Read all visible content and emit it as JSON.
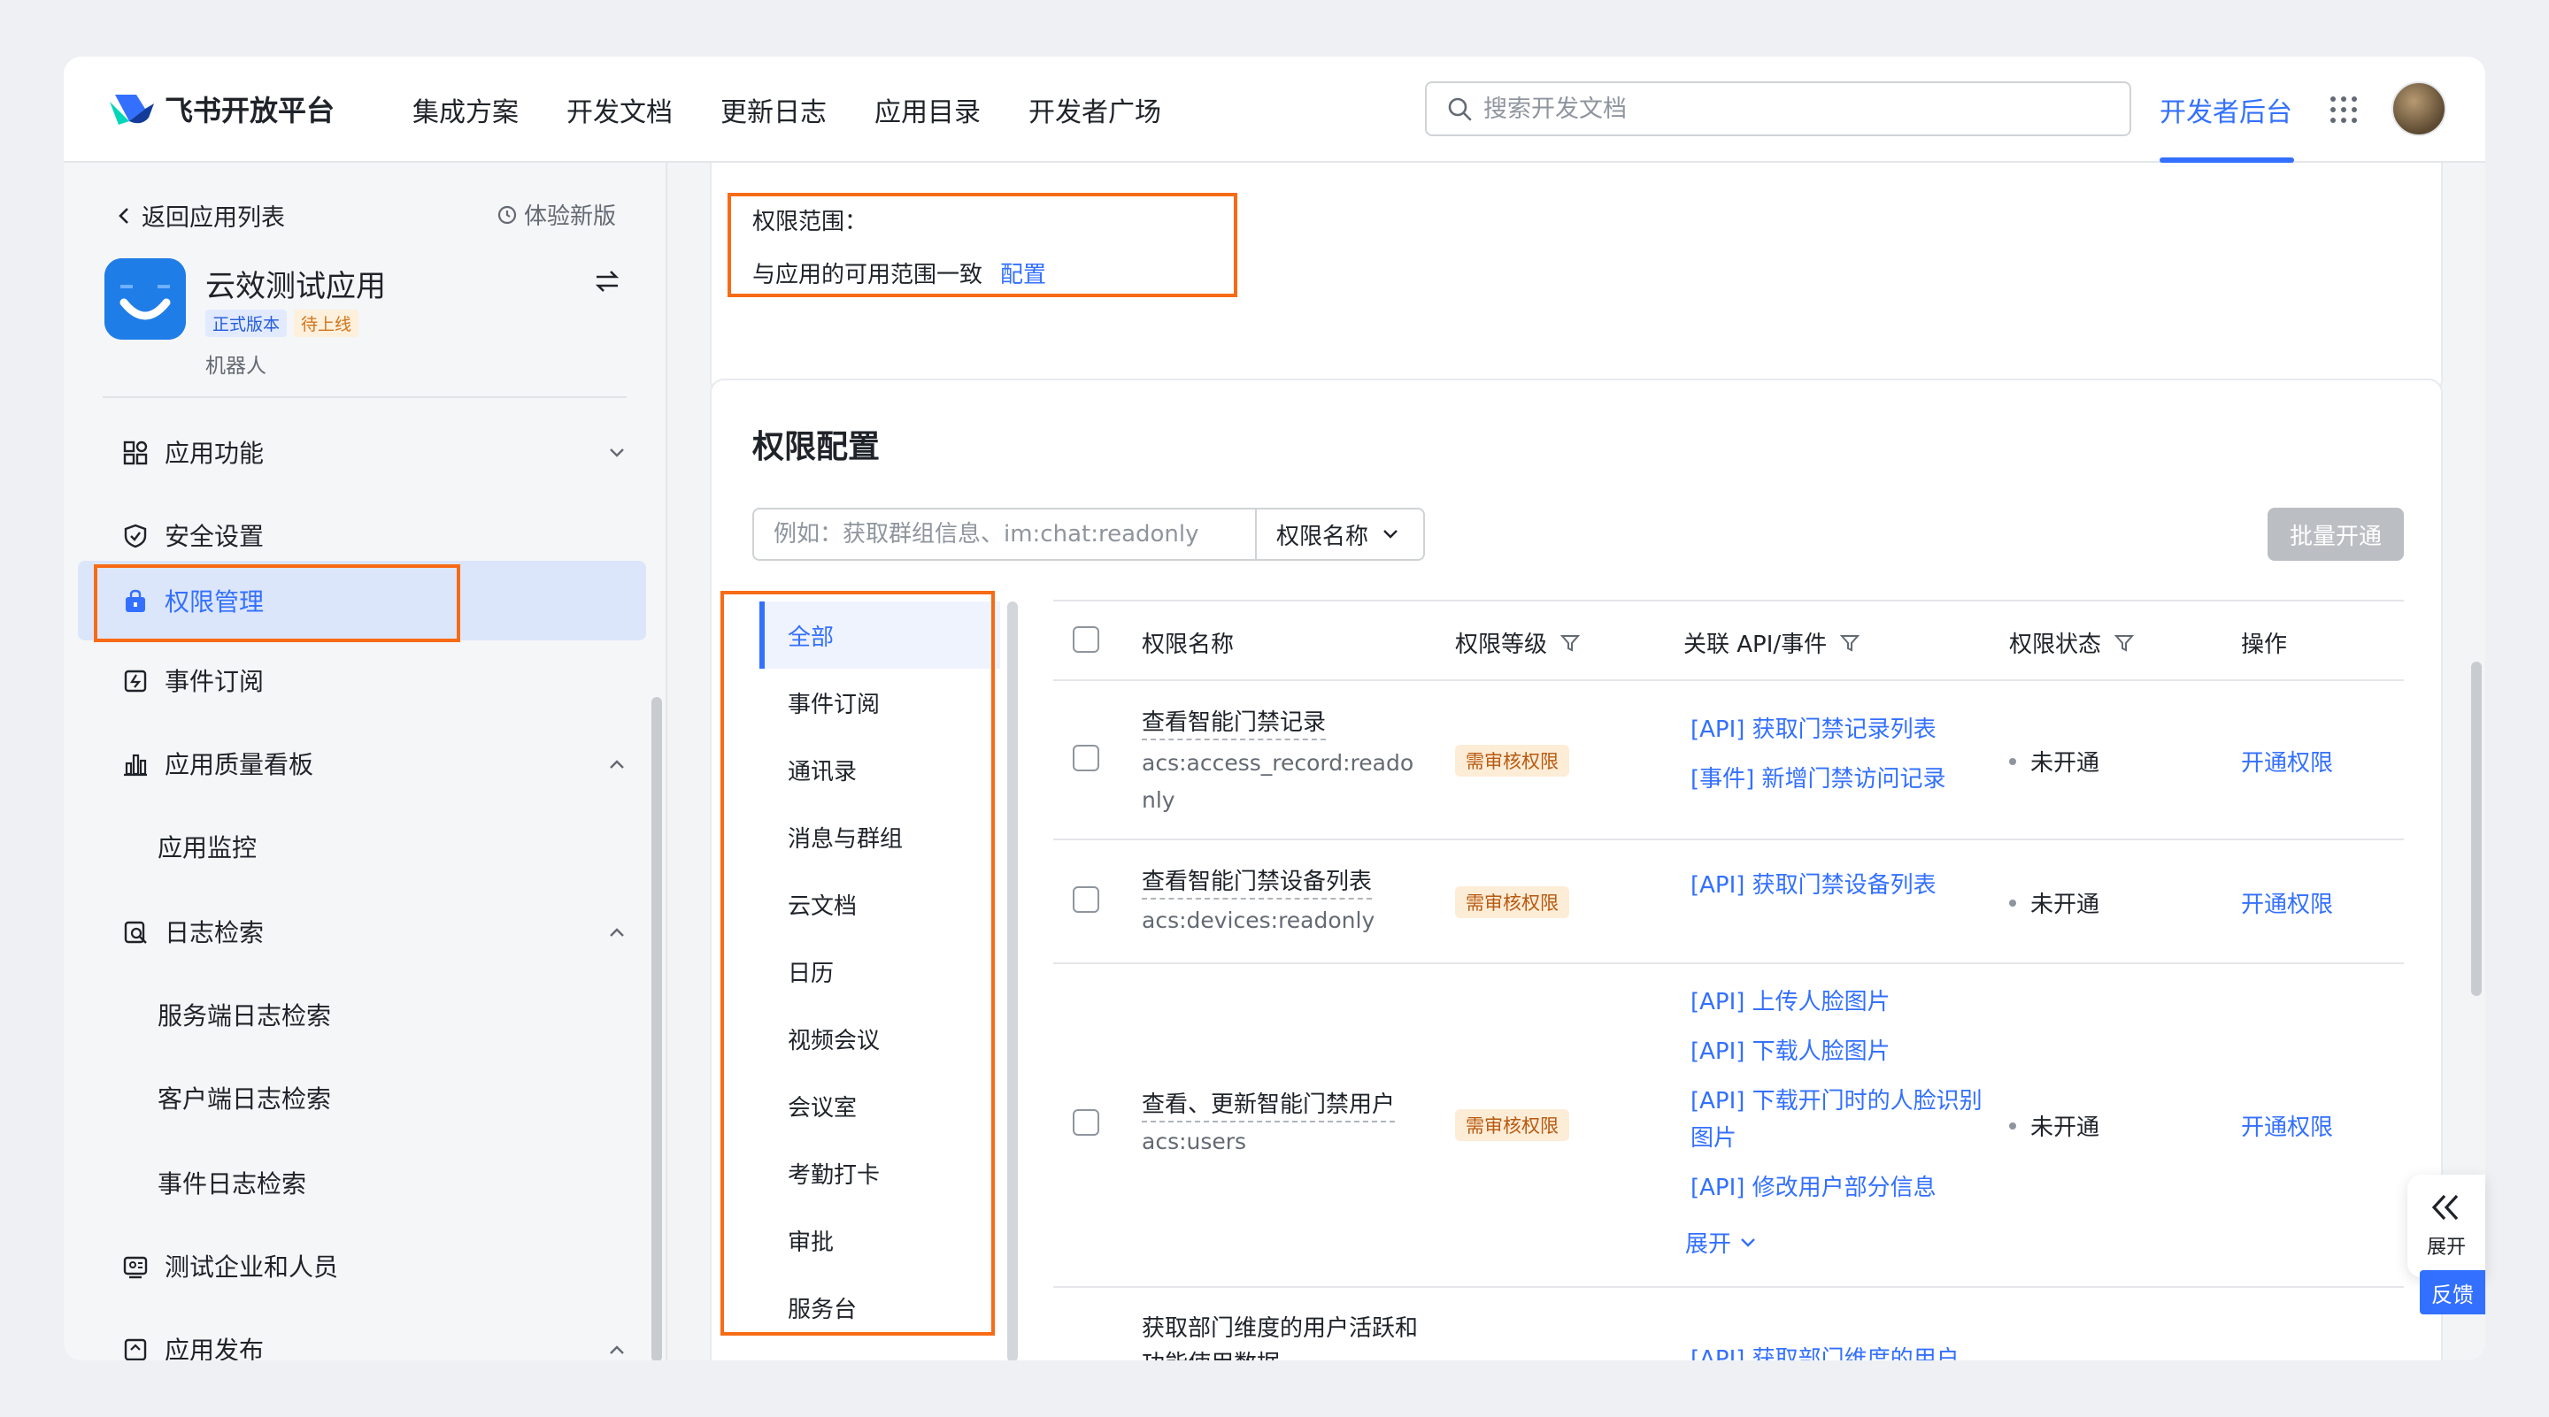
{
  "header": {
    "logo_text": "飞书开放平台",
    "nav": [
      "集成方案",
      "开发文档",
      "更新日志",
      "应用目录",
      "开发者广场"
    ],
    "search_placeholder": "搜索开发文档",
    "dev_console": "开发者后台"
  },
  "sidebar": {
    "back": "返回应用列表",
    "try_new": "体验新版",
    "app_name": "云效测试应用",
    "badges": [
      "正式版本",
      "待上线"
    ],
    "app_type": "机器人",
    "items": [
      {
        "label": "应用功能",
        "icon": "grid-apps-icon",
        "chevron": "down"
      },
      {
        "label": "安全设置",
        "icon": "shield-icon"
      },
      {
        "label": "权限管理",
        "icon": "lock-bag-icon",
        "active": true
      },
      {
        "label": "事件订阅",
        "icon": "event-icon"
      },
      {
        "label": "应用质量看板",
        "icon": "bar-chart-icon",
        "chevron": "up"
      },
      {
        "label": "应用监控",
        "sub": true
      },
      {
        "label": "日志检索",
        "icon": "log-search-icon",
        "chevron": "up"
      },
      {
        "label": "服务端日志检索",
        "sub": true
      },
      {
        "label": "客户端日志检索",
        "sub": true
      },
      {
        "label": "事件日志检索",
        "sub": true
      },
      {
        "label": "测试企业和人员",
        "icon": "test-org-icon"
      },
      {
        "label": "应用发布",
        "icon": "publish-icon",
        "chevron": "up"
      }
    ]
  },
  "scope": {
    "label": "权限范围：",
    "value": "与应用的可用范围一致",
    "link": "配置"
  },
  "permissions": {
    "title": "权限配置",
    "filter_placeholder": "例如：获取群组信息、im:chat:readonly",
    "filter_select": "权限名称",
    "bulk_button": "批量开通",
    "categories": [
      "全部",
      "事件订阅",
      "通讯录",
      "消息与群组",
      "云文档",
      "日历",
      "视频会议",
      "会议室",
      "考勤打卡",
      "审批",
      "服务台"
    ],
    "columns": [
      "权限名称",
      "权限等级",
      "关联 API/事件",
      "权限状态",
      "操作"
    ],
    "rows": [
      {
        "name": "查看智能门禁记录",
        "code": "acs:access_record:readonly",
        "level": "需审核权限",
        "apis": [
          "[API] 获取门禁记录列表",
          "[事件] 新增门禁访问记录"
        ],
        "status": "未开通",
        "action": "开通权限"
      },
      {
        "name": "查看智能门禁设备列表",
        "code": "acs:devices:readonly",
        "level": "需审核权限",
        "apis": [
          "[API] 获取门禁设备列表"
        ],
        "status": "未开通",
        "action": "开通权限"
      },
      {
        "name": "查看、更新智能门禁用户",
        "code": "acs:users",
        "level": "需审核权限",
        "apis": [
          "[API] 上传人脸图片",
          "[API] 下载人脸图片",
          "[API] 下载开门时的人脸识别图片",
          "[API] 修改用户部分信息"
        ],
        "expand": "展开",
        "status": "未开通",
        "action": "开通权限"
      },
      {
        "name": "获取部门维度的用户活跃和功能使用数据",
        "api": "[API] 获取部门维度的用户"
      }
    ]
  },
  "floating": {
    "expand": "展开",
    "feedback": "反馈"
  }
}
